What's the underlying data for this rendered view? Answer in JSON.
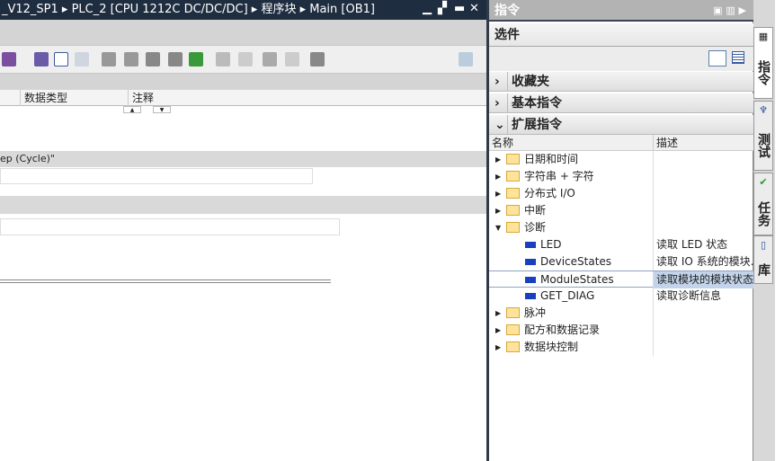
{
  "editor": {
    "title": "_V12_SP1 ▸ PLC_2 [CPU 1212C DC/DC/DC] ▸ 程序块 ▸ Main [OB1]",
    "window_buttons": [
      "minimize-icon",
      "restore-icon",
      "maximize-icon",
      "close-icon"
    ],
    "columns": [
      "数据类型",
      "注释"
    ],
    "network_title": "ep (Cycle)\""
  },
  "instructions": {
    "title": "指令",
    "options_label": "选件",
    "sections": [
      {
        "label": "收藏夹",
        "expanded": false
      },
      {
        "label": "基本指令",
        "expanded": false
      },
      {
        "label": "扩展指令",
        "expanded": true
      }
    ],
    "col_name": "名称",
    "col_desc": "描述",
    "rows": [
      {
        "name": "日期和时间",
        "type": "folder",
        "expanded": false,
        "desc": ""
      },
      {
        "name": "字符串 + 字符",
        "type": "folder",
        "expanded": false,
        "desc": ""
      },
      {
        "name": "分布式 I/O",
        "type": "folder",
        "expanded": false,
        "desc": ""
      },
      {
        "name": "中断",
        "type": "folder",
        "expanded": false,
        "desc": ""
      },
      {
        "name": "诊断",
        "type": "folder",
        "expanded": true,
        "desc": ""
      },
      {
        "name": "LED",
        "type": "block",
        "desc": "读取 LED 状态"
      },
      {
        "name": "DeviceStates",
        "type": "block",
        "desc": "读取 IO 系统的模块..."
      },
      {
        "name": "ModuleStates",
        "type": "block",
        "desc": "读取模块的模块状态",
        "selected": true
      },
      {
        "name": "GET_DIAG",
        "type": "block",
        "desc": "读取诊断信息"
      },
      {
        "name": "脉冲",
        "type": "folder",
        "expanded": false,
        "desc": ""
      },
      {
        "name": "配方和数据记录",
        "type": "folder",
        "expanded": false,
        "desc": ""
      },
      {
        "name": "数据块控制",
        "type": "folder",
        "expanded": false,
        "desc": ""
      }
    ]
  },
  "side_tabs": [
    {
      "label": "指令",
      "icon": "instructions-icon"
    },
    {
      "label": "测试",
      "icon": "test-icon"
    },
    {
      "label": "任务",
      "icon": "tasks-icon"
    },
    {
      "label": "库",
      "icon": "library-icon"
    }
  ]
}
